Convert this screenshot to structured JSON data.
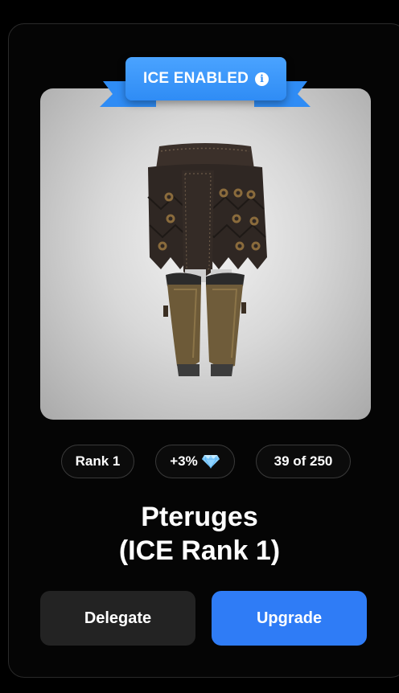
{
  "badge": {
    "label": "ICE ENABLED",
    "info_icon": "info-icon",
    "color": "#3a96fb"
  },
  "product": {
    "image_icon": "pteruges-armor-image",
    "title_line1": "Pteruges",
    "title_line2": "(ICE Rank 1)"
  },
  "stats": {
    "rank": "Rank 1",
    "bonus": "+3%",
    "bonus_icon": "diamond-icon",
    "count": "39 of 250"
  },
  "actions": {
    "delegate_label": "Delegate",
    "upgrade_label": "Upgrade",
    "upgrade_color": "#2f7cf6"
  }
}
